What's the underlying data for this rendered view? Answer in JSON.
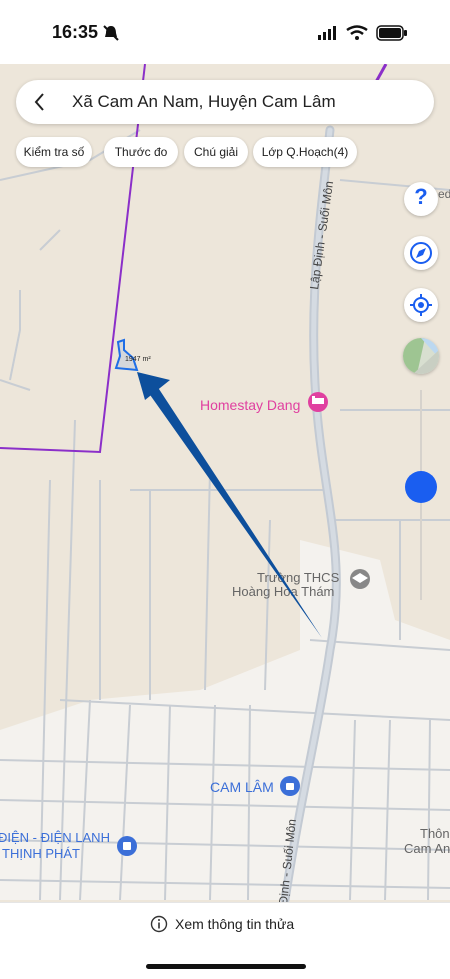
{
  "status_bar": {
    "time": "16:35"
  },
  "header": {
    "title": "Xã Cam An Nam, Huyện Cam Lâm"
  },
  "chips": [
    "Kiểm tra số",
    "Thước đo",
    "Chú giải",
    "Lớp Q.Hoạch(4)"
  ],
  "controls": {
    "help_label": "?",
    "zoom_level": 0.5
  },
  "map": {
    "parcel_area": "1947 m²",
    "road_labels": {
      "top": "Lập Định - Suối Môn",
      "bottom": "Định - Suối Môn"
    },
    "pois": {
      "homestay": "Homestay Dang",
      "school_line1": "Trường THCS",
      "school_line2": "Hoàng Hoa Thám",
      "town": "CAM LÂM",
      "shop_line1": "ĐIỆN - ĐIỆN LANH",
      "shop_line2": "THỊNH PHÁT",
      "edge_line1": "Thôn",
      "edge_line2": "Cam An",
      "edge_top": "ed"
    }
  },
  "colors": {
    "boundary": "#8b2fc9",
    "poi_pink": "#e040a0",
    "poi_blue": "#3b6fd8",
    "arrow": "#0d4f9c",
    "slider": "#1a5ef0"
  },
  "bottom": {
    "info_label": "Xem thông tin thửa"
  }
}
